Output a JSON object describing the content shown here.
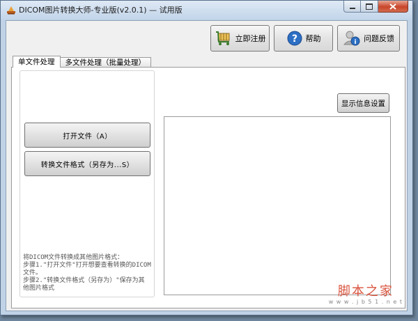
{
  "window": {
    "title": "DICOM图片转换大师-专业版(v2.0.1) — 试用版"
  },
  "toolbar": {
    "register_label": "立即注册",
    "help_label": "帮助",
    "feedback_label": "问题反馈"
  },
  "tabs": [
    {
      "label": "单文件处理"
    },
    {
      "label": "多文件处理（批量处理）"
    }
  ],
  "single": {
    "open_label": "打开文件（A）",
    "convert_label": "转换文件格式（另存为...S）",
    "help_lines": [
      "将DICOM文件转换成其他图片格式：",
      "  步骤1.\"打开文件\"打开想要查看转换的DICOM",
      "文件。",
      "  步骤2.\"转换文件格式（另存为）\"保存为其",
      "他图片格式"
    ],
    "display_settings_label": "显示信息设置"
  },
  "watermark": {
    "main": "脚本之家",
    "url": "w w w . j b 5 1 . n e t"
  },
  "colors": {
    "titlebar": "#c2d5ea",
    "close_button": "#c8452b",
    "watermark": "#d9533d"
  }
}
